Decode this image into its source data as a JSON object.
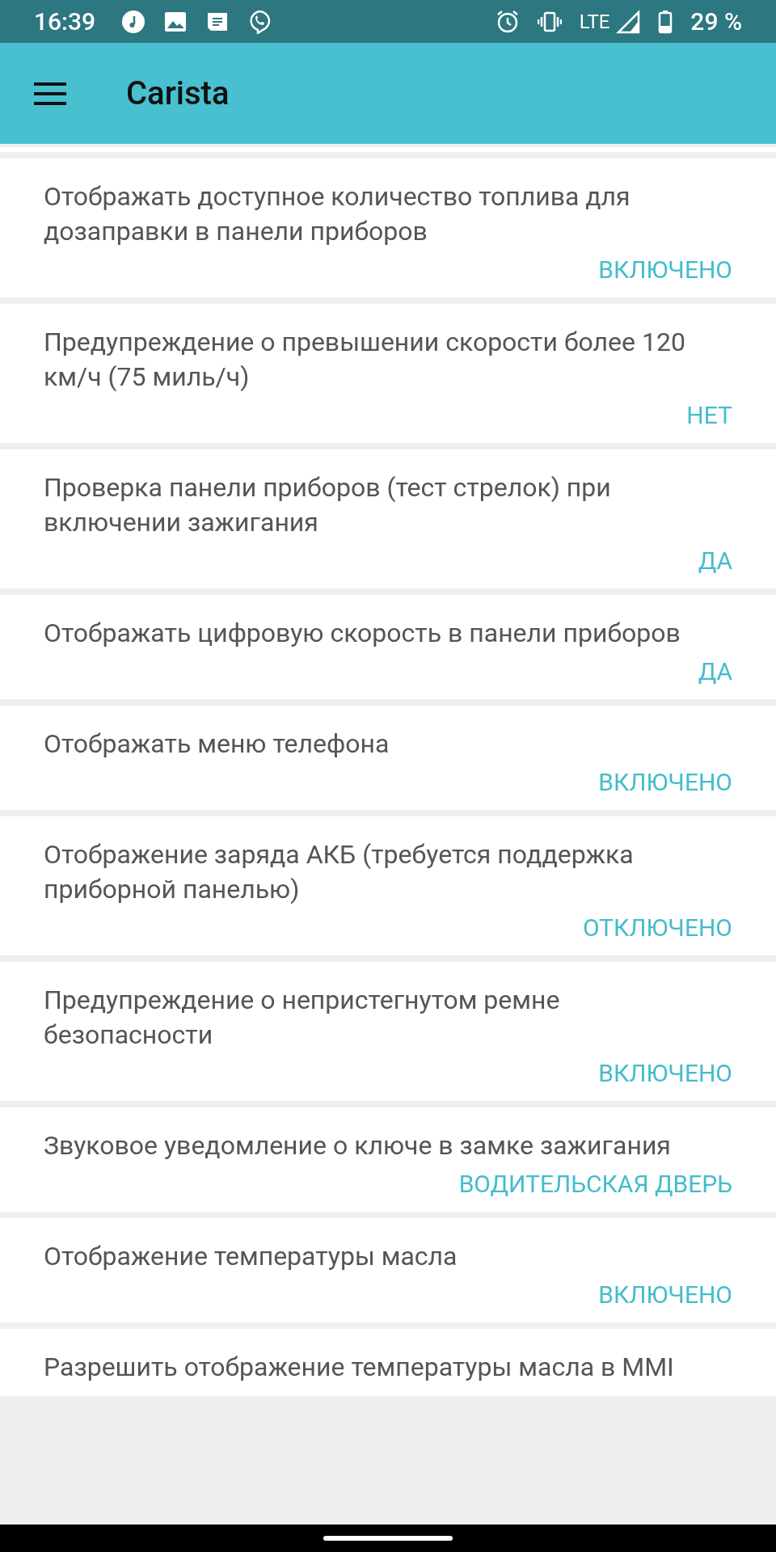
{
  "status_bar": {
    "time": "16:39",
    "network": "LTE",
    "battery": "29 %"
  },
  "toolbar": {
    "title": "Carista"
  },
  "settings": [
    {
      "title": "Отображать доступное количество топлива для дозаправки в панели приборов",
      "value": "ВКЛЮЧЕНО"
    },
    {
      "title": "Предупреждение о превышении скорости более 120 км/ч (75 миль/ч)",
      "value": "НЕТ"
    },
    {
      "title": "Проверка панели приборов (тест стрелок) при включении зажигания",
      "value": "ДА"
    },
    {
      "title": "Отображать цифровую скорость в панели приборов",
      "value": "ДА"
    },
    {
      "title": "Отображать меню телефона",
      "value": "ВКЛЮЧЕНО"
    },
    {
      "title": "Отображение заряда АКБ (требуется поддержка приборной панелью)",
      "value": "ОТКЛЮЧЕНО"
    },
    {
      "title": "Предупреждение о непристегнутом ремне безопасности",
      "value": "ВКЛЮЧЕНО"
    },
    {
      "title": "Звуковое уведомление о ключе в замке зажигания",
      "value": "ВОДИТЕЛЬСКАЯ ДВЕРЬ"
    },
    {
      "title": "Отображение температуры масла",
      "value": "ВКЛЮЧЕНО"
    },
    {
      "title": "Разрешить отображение температуры масла в MMI"
    }
  ]
}
